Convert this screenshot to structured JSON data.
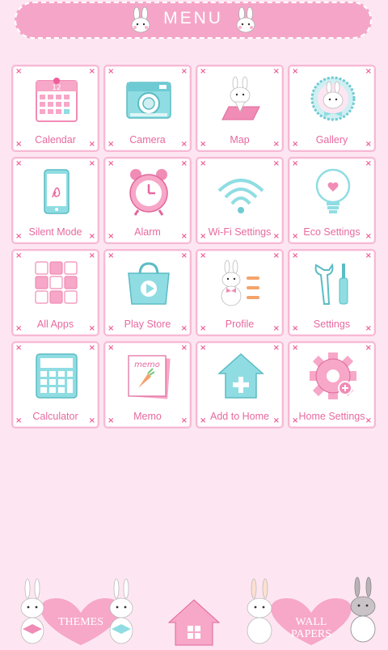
{
  "header": {
    "title": "MENU"
  },
  "apps": [
    {
      "label": "Calendar",
      "icon": "calendar-icon",
      "date": "12"
    },
    {
      "label": "Camera",
      "icon": "camera-icon"
    },
    {
      "label": "Map",
      "icon": "map-icon"
    },
    {
      "label": "Gallery",
      "icon": "gallery-icon"
    },
    {
      "label": "Silent Mode",
      "icon": "phone-icon"
    },
    {
      "label": "Alarm",
      "icon": "alarm-clock-icon"
    },
    {
      "label": "Wi-Fi Settings",
      "icon": "wifi-icon"
    },
    {
      "label": "Eco Settings",
      "icon": "lightbulb-icon"
    },
    {
      "label": "All Apps",
      "icon": "grid-icon"
    },
    {
      "label": "Play Store",
      "icon": "shopping-bag-icon"
    },
    {
      "label": "Profile",
      "icon": "bunny-profile-icon"
    },
    {
      "label": "Settings",
      "icon": "tools-icon"
    },
    {
      "label": "Calculator",
      "icon": "calculator-icon"
    },
    {
      "label": "Memo",
      "icon": "memo-icon",
      "memo_text": "memo"
    },
    {
      "label": "Add to Home",
      "icon": "add-home-icon"
    },
    {
      "label": "Home Settings",
      "icon": "gear-icon"
    }
  ],
  "dock": {
    "themes_label": "THEMES",
    "wallpapers_line1": "WALL",
    "wallpapers_line2": "PAPERS"
  },
  "colors": {
    "pink": "#f5a6c8",
    "accent": "#ee5f9a",
    "aqua": "#8fdde3",
    "background": "#fde6f2"
  }
}
